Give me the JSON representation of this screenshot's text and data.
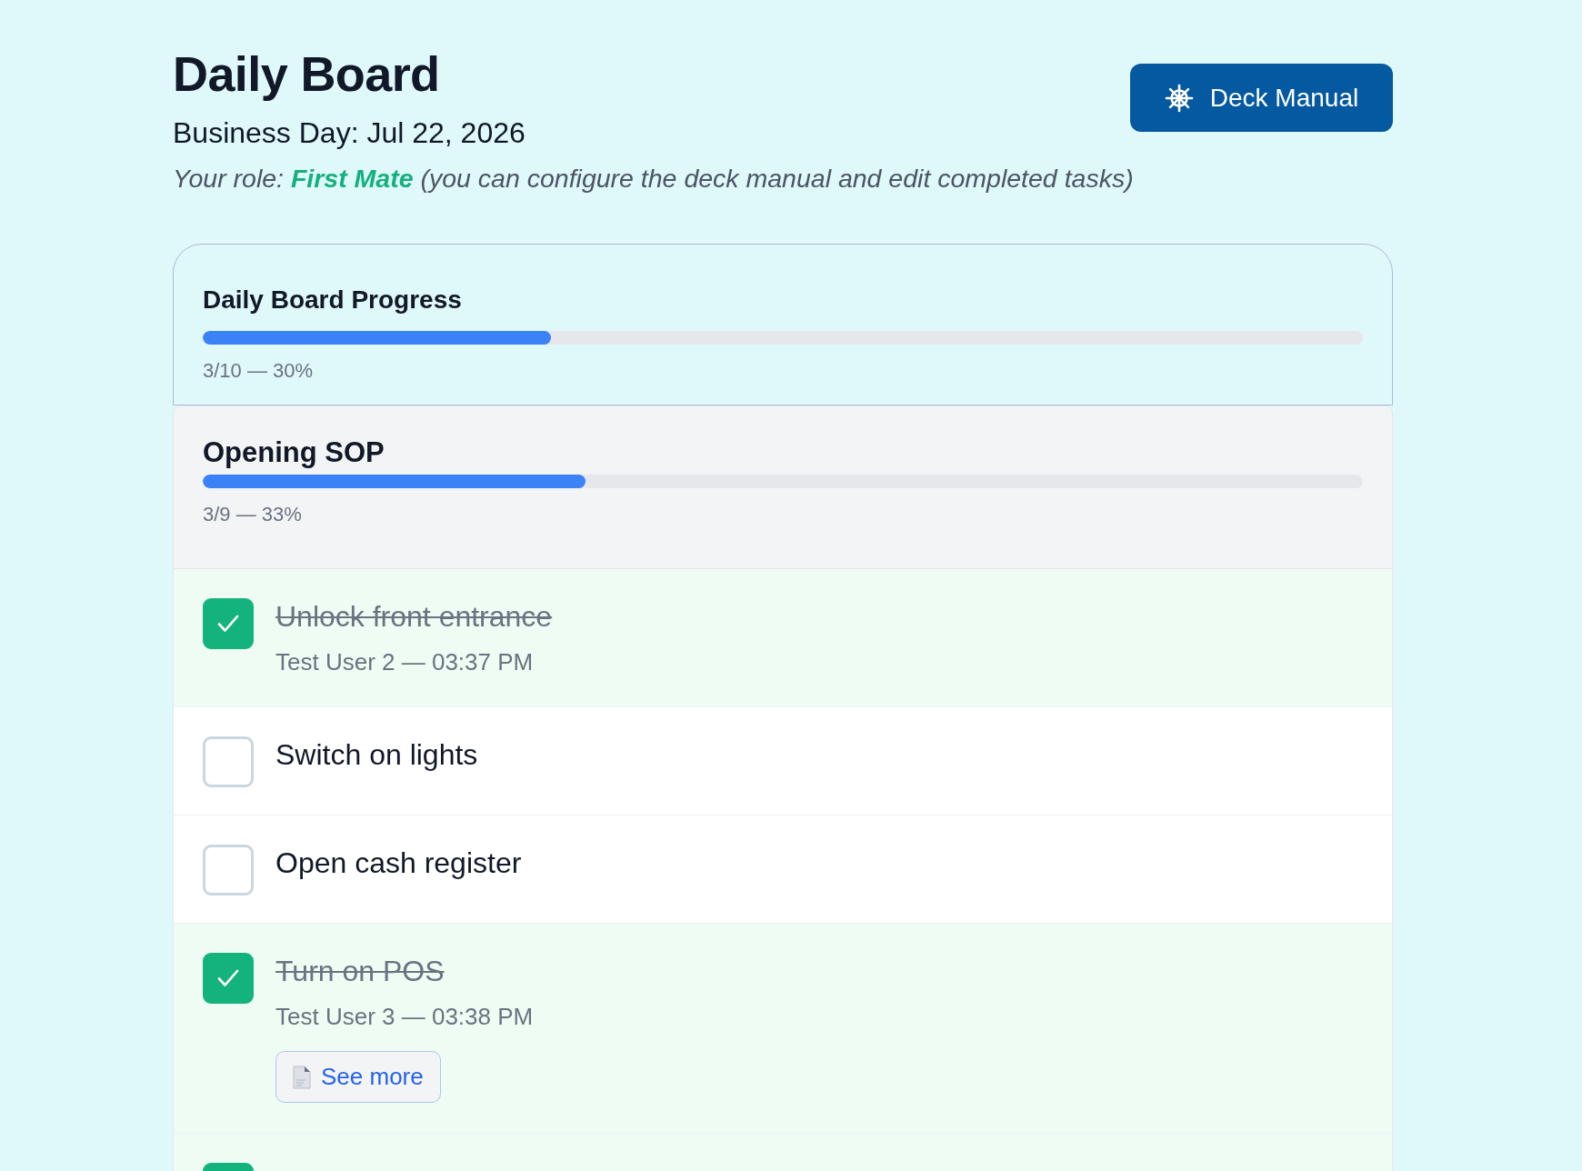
{
  "header": {
    "title": "Daily Board",
    "business_day": "Business Day: Jul 22, 2026",
    "role_note": "Your role: **First Mate** (you can configure the deck manual and edit completed tasks)",
    "deck_manual_button": {
      "label": "Deck Manual"
    }
  },
  "overall_progress": {
    "title": "Daily Board Progress",
    "level": 0.3,
    "reading": "3/10 — 30%"
  },
  "sections": [
    {
      "title": "Opening SOP",
      "level": 0.33,
      "reading": "3/9 — 33%",
      "tasks": [
        {
          "label": "Unlock front entrance",
          "checked": true,
          "completed_by": "Test User 2 — 03:37 PM"
        },
        {
          "label": "Switch on lights",
          "checked": false
        },
        {
          "label": "Open cash register",
          "checked": false
        },
        {
          "label": "Turn on POS",
          "checked": true,
          "completed_by": "Test User 3 — 03:38 PM",
          "attachment_button": {
            "label": "See more"
          }
        },
        {
          "checked": true
        }
      ]
    }
  ]
}
